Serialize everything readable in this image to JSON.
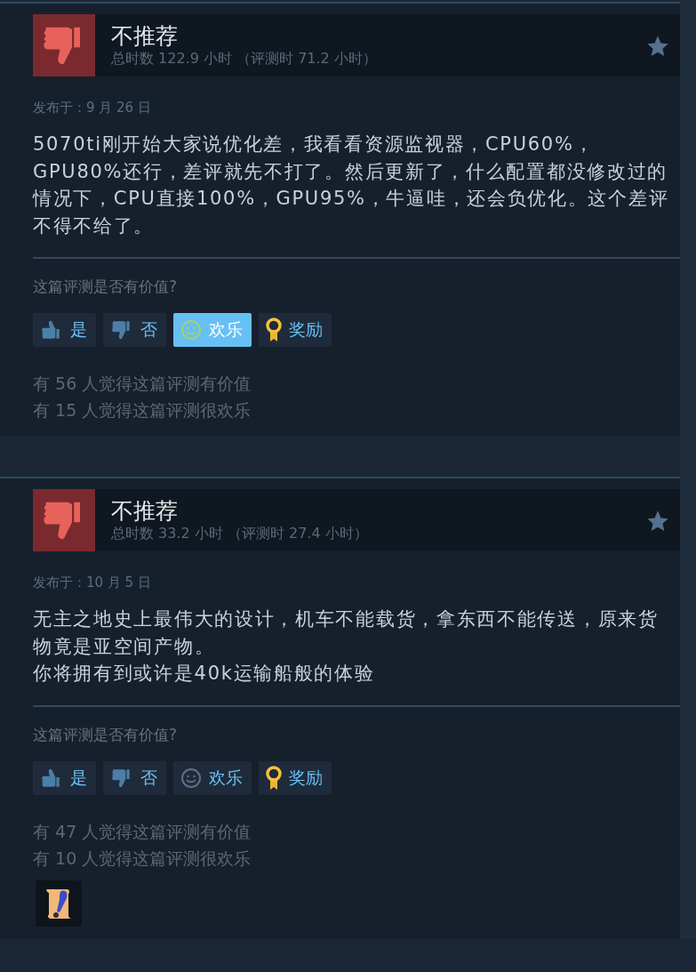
{
  "reviews": [
    {
      "verdict": "不推荐",
      "recommended": false,
      "hours": "总时数 122.9 小时 （评测时 71.2 小时）",
      "posted": "发布于：9 月 26 日",
      "paragraphs": [
        "5070ti刚开始大家说优化差，我看看资源监视器，CPU60%，GPU80%还行，差评就先不打了。然后更新了，什么配置都没修改过的情况下，CPU直接100%，GPU95%，牛逼哇，还会负优化。这个差评不得不给了。"
      ],
      "question": "这篇评测是否有价值?",
      "buttons": [
        {
          "kind": "yes",
          "label": "是",
          "selected": false
        },
        {
          "kind": "no",
          "label": "否",
          "selected": false
        },
        {
          "kind": "funny",
          "label": "欢乐",
          "selected": true
        },
        {
          "kind": "award",
          "label": "奖励",
          "selected": false
        }
      ],
      "stats": [
        "有 56 人觉得这篇评测有价值",
        "有 15 人觉得这篇评测很欢乐"
      ]
    },
    {
      "verdict": "不推荐",
      "recommended": false,
      "hours": "总时数 33.2 小时 （评测时 27.4 小时）",
      "posted": "发布于：10 月 5 日",
      "paragraphs": [
        "无主之地史上最伟大的设计，机车不能载货，拿东西不能传送，原来货物竟是亚空间产物。",
        "你将拥有到或许是40k运输船般的体验"
      ],
      "question": "这篇评测是否有价值?",
      "buttons": [
        {
          "kind": "yes",
          "label": "是",
          "selected": false
        },
        {
          "kind": "no",
          "label": "否",
          "selected": false
        },
        {
          "kind": "funny",
          "label": "欢乐",
          "selected": false
        },
        {
          "kind": "award",
          "label": "奖励",
          "selected": false
        }
      ],
      "stats": [
        "有 47 人觉得这篇评测有价值",
        "有 10 人觉得这篇评测很欢乐"
      ],
      "awards": [
        {
          "kind": "scroll"
        }
      ]
    }
  ]
}
